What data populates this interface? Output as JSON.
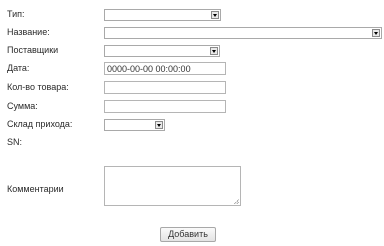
{
  "form": {
    "type_label": "Тип:",
    "name_label": "Название:",
    "supplier_label": "Поставщики",
    "date_label": "Дата:",
    "date_value": "0000-00-00 00:00:00",
    "qty_label": "Кол-во товара:",
    "sum_label": "Сумма:",
    "warehouse_label": "Склад прихода:",
    "sn_label": "SN:",
    "comment_label": "Комментарии",
    "submit_label": "Добавить"
  }
}
